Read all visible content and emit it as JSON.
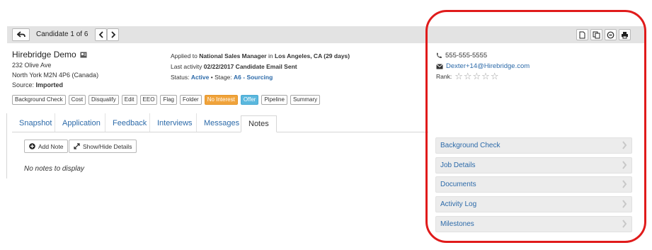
{
  "header": {
    "candidate_counter": "Candidate 1 of 6",
    "toolbar_icons": [
      "back-icon",
      "chevron-left-icon",
      "chevron-right-icon",
      "document-icon",
      "copy-icon",
      "circle-arrow-icon",
      "print-icon"
    ]
  },
  "candidate": {
    "name": "Hirebridge Demo",
    "address_line1": "232 Olive Ave",
    "address_line2": "North York M2N 4P6 (Canada)",
    "source_label": "Source:",
    "source_value": "Imported"
  },
  "application": {
    "applied_prefix": "Applied to",
    "job_title": "National Sales Manager",
    "in_label": "in",
    "location": "Los Angeles, CA (29 days)",
    "last_activity_label": "Last activity",
    "last_activity_value": "02/22/2017 Candidate Email Sent",
    "status_label": "Status:",
    "status_value": "Active",
    "stage_label": "• Stage:",
    "stage_value": "A6 - Sourcing"
  },
  "actions": [
    {
      "label": "Background Check",
      "style": "default"
    },
    {
      "label": "Cost",
      "style": "default"
    },
    {
      "label": "Disqualify",
      "style": "default"
    },
    {
      "label": "Edit",
      "style": "default"
    },
    {
      "label": "EEO",
      "style": "default"
    },
    {
      "label": "Flag",
      "style": "default"
    },
    {
      "label": "Folder",
      "style": "default"
    },
    {
      "label": "No Interest",
      "style": "orange"
    },
    {
      "label": "Offer",
      "style": "blue"
    },
    {
      "label": "Pipeline",
      "style": "default"
    },
    {
      "label": "Summary",
      "style": "default"
    }
  ],
  "tabs": [
    {
      "label": "Snapshot",
      "active": false
    },
    {
      "label": "Application",
      "active": false
    },
    {
      "label": "Feedback",
      "active": false
    },
    {
      "label": "Interviews",
      "active": false
    },
    {
      "label": "Messages",
      "active": false
    },
    {
      "label": "Notes",
      "active": true
    }
  ],
  "notes": {
    "add_note_label": "Add Note",
    "show_hide_label": "Show/Hide Details",
    "empty_text": "No notes to display"
  },
  "contact": {
    "phone": "555-555-5555",
    "email": "Dexter+14@Hirebridge.com",
    "rank_label": "Rank:",
    "rank_value": 0,
    "rank_max": 5,
    "stars_text": "☆☆☆☆☆"
  },
  "sidebar_panels": [
    {
      "label": "Background Check"
    },
    {
      "label": "Job Details"
    },
    {
      "label": "Documents"
    },
    {
      "label": "Activity Log"
    },
    {
      "label": "Milestones"
    }
  ],
  "colors": {
    "link": "#2c6aa9",
    "orange_button": "#f0a33b",
    "blue_button": "#5bb8de",
    "highlight_circle": "#e01b1b"
  }
}
